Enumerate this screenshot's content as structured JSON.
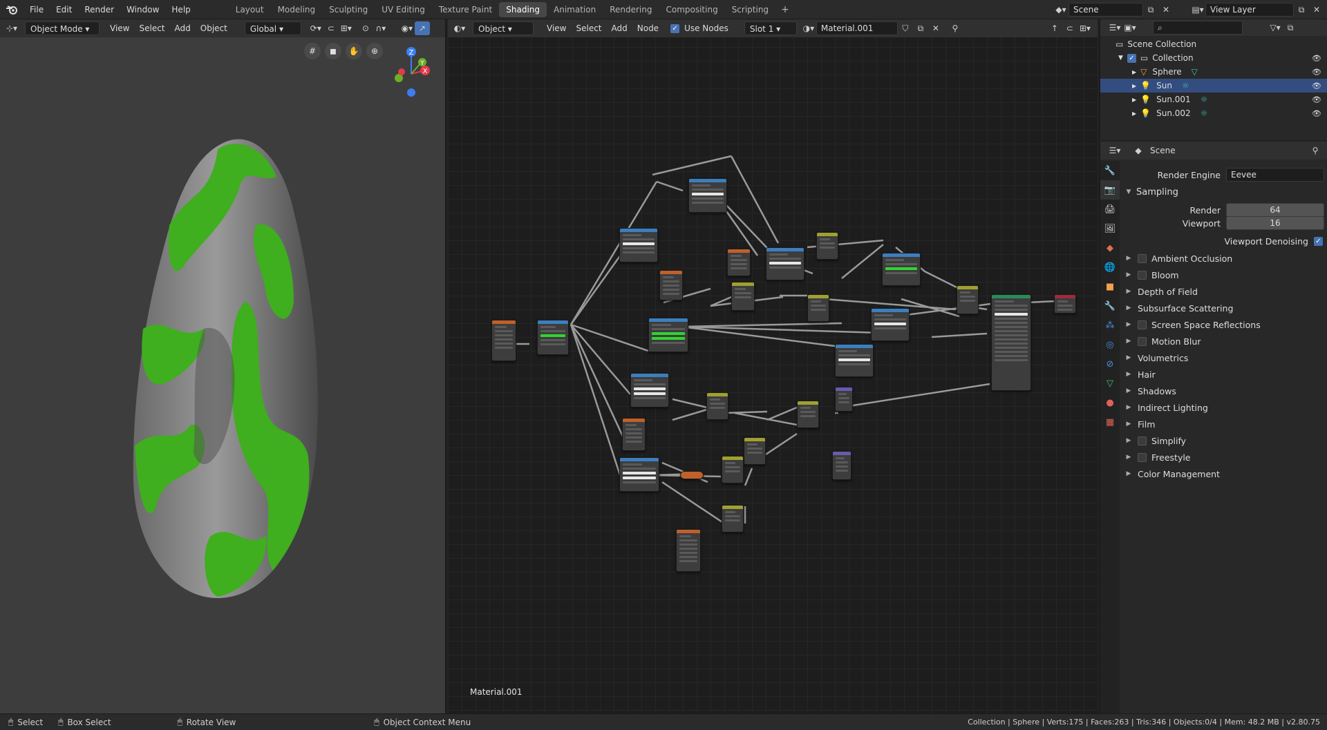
{
  "topbar": {
    "menus": [
      "File",
      "Edit",
      "Render",
      "Window",
      "Help"
    ],
    "workspaces": [
      "Layout",
      "Modeling",
      "Sculpting",
      "UV Editing",
      "Texture Paint",
      "Shading",
      "Animation",
      "Rendering",
      "Compositing",
      "Scripting"
    ],
    "active_workspace": "Shading",
    "add_symbol": "+",
    "scene": "Scene",
    "view_layer": "View Layer"
  },
  "viewport": {
    "mode": "Object Mode",
    "menus": [
      "View",
      "Select",
      "Add",
      "Object"
    ],
    "transform": "Global",
    "gizmo_labels": {
      "z": "Z",
      "y": "Y",
      "x": "X"
    }
  },
  "node_editor": {
    "type": "Object",
    "menus": [
      "View",
      "Select",
      "Add",
      "Node"
    ],
    "use_nodes_label": "Use Nodes",
    "slot": "Slot 1",
    "material": "Material.001",
    "footer_label": "Material.001"
  },
  "outliner": {
    "root": "Scene Collection",
    "collection": "Collection",
    "items": [
      "Sphere",
      "Sun",
      "Sun.001",
      "Sun.002"
    ],
    "selected": "Sun"
  },
  "properties": {
    "context": "Scene",
    "render_engine_label": "Render Engine",
    "render_engine": "Eevee",
    "sampling_title": "Sampling",
    "render_label": "Render",
    "render_samples": "64",
    "viewport_label": "Viewport",
    "viewport_samples": "16",
    "denoise_label": "Viewport Denoising",
    "panels": [
      {
        "label": "Ambient Occlusion",
        "checkbox": true
      },
      {
        "label": "Bloom",
        "checkbox": true
      },
      {
        "label": "Depth of Field",
        "checkbox": false
      },
      {
        "label": "Subsurface Scattering",
        "checkbox": false
      },
      {
        "label": "Screen Space Reflections",
        "checkbox": true
      },
      {
        "label": "Motion Blur",
        "checkbox": true
      },
      {
        "label": "Volumetrics",
        "checkbox": false
      },
      {
        "label": "Hair",
        "checkbox": false
      },
      {
        "label": "Shadows",
        "checkbox": false
      },
      {
        "label": "Indirect Lighting",
        "checkbox": false
      },
      {
        "label": "Film",
        "checkbox": false
      },
      {
        "label": "Simplify",
        "checkbox": true
      },
      {
        "label": "Freestyle",
        "checkbox": true
      },
      {
        "label": "Color Management",
        "checkbox": false
      }
    ]
  },
  "statusbar": {
    "select": "Select",
    "box_select": "Box Select",
    "rotate": "Rotate View",
    "context_menu": "Object Context Menu",
    "stats": "Collection | Sphere | Verts:175 | Faces:263 | Tris:346 | Objects:0/4 | Mem: 48.2 MB | v2.80.75"
  },
  "colors": {
    "accent": "#4772b3",
    "selected_row": "#334d80",
    "grass": "#3fae1f",
    "rock": "#8a8a8a"
  }
}
